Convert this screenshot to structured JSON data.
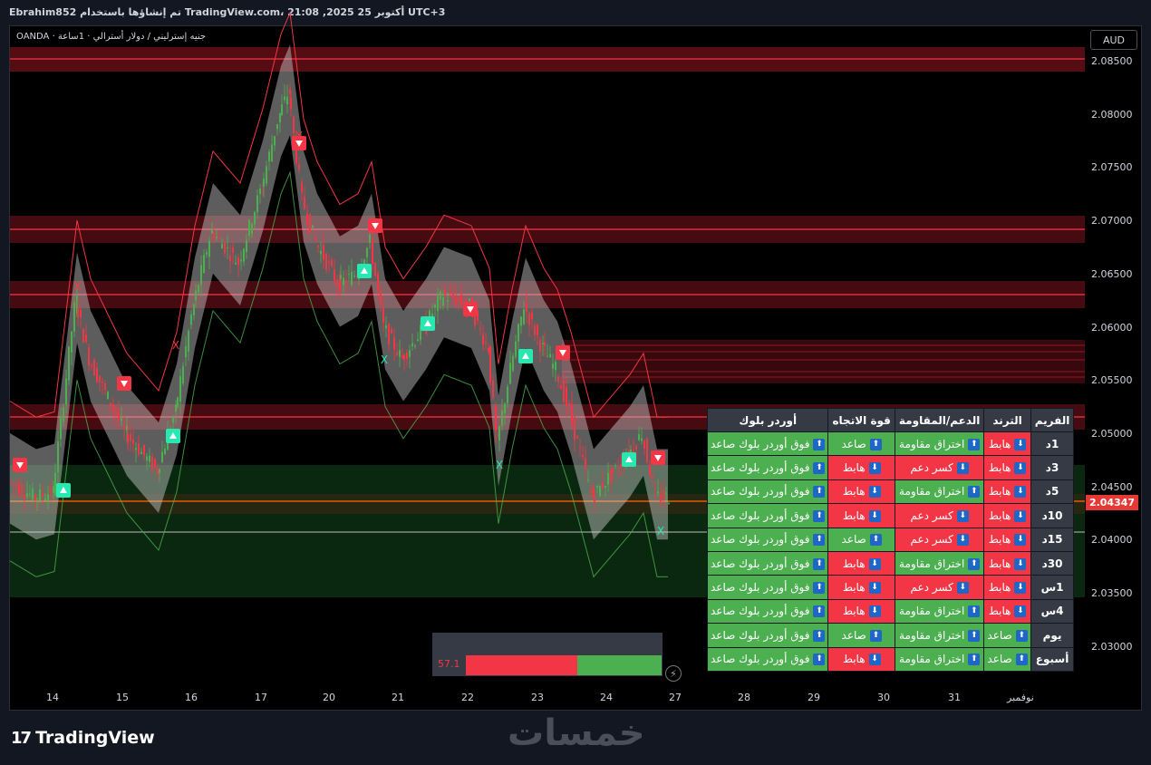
{
  "header": {
    "title": "Ebrahim852 تم إنشاؤها باستخدام TradingView.com، 21:08 ,2025 أكتوبر 25 UTC+3"
  },
  "symbol": {
    "label": "جنيه إسترليني / دولار أسترالي · 1ساعة · OANDA"
  },
  "currency_button": {
    "label": "AUD"
  },
  "price_axis": {
    "labels": [
      "2.08500",
      "2.08000",
      "2.07500",
      "2.07000",
      "2.06500",
      "2.06000",
      "2.05500",
      "2.05000",
      "2.04500",
      "2.04000",
      "2.03500",
      "2.03000"
    ],
    "last_price": "2.04347"
  },
  "time_axis": {
    "labels": [
      "14",
      "15",
      "16",
      "17",
      "20",
      "21",
      "22",
      "23",
      "24",
      "27",
      "28",
      "29",
      "30",
      "31",
      "نوفمبر"
    ]
  },
  "markers": {
    "x_label": "X"
  },
  "table": {
    "headers": [
      "الفريم",
      "الترند",
      "الدعم/المقاومة",
      "قوة الاتجاه",
      "أوردر بلوك"
    ],
    "rows": [
      {
        "frame": "1د",
        "trend": "هابط",
        "sr": "اختراق مقاومة",
        "strength": "صاعد",
        "ob": "فوق أوردر بلوك صاعد"
      },
      {
        "frame": "3د",
        "trend": "هابط",
        "sr": "كسر دعم",
        "strength": "هابط",
        "ob": "فوق أوردر بلوك صاعد"
      },
      {
        "frame": "5د",
        "trend": "هابط",
        "sr": "اختراق مقاومة",
        "strength": "هابط",
        "ob": "فوق أوردر بلوك صاعد"
      },
      {
        "frame": "10د",
        "trend": "هابط",
        "sr": "كسر دعم",
        "strength": "هابط",
        "ob": "فوق أوردر بلوك صاعد"
      },
      {
        "frame": "15د",
        "trend": "هابط",
        "sr": "كسر دعم",
        "strength": "صاعد",
        "ob": "فوق أوردر بلوك صاعد"
      },
      {
        "frame": "30د",
        "trend": "هابط",
        "sr": "اختراق مقاومة",
        "strength": "هابط",
        "ob": "فوق أوردر بلوك صاعد"
      },
      {
        "frame": "1س",
        "trend": "هابط",
        "sr": "كسر دعم",
        "strength": "هابط",
        "ob": "فوق أوردر بلوك صاعد"
      },
      {
        "frame": "4س",
        "trend": "هابط",
        "sr": "اختراق مقاومة",
        "strength": "هابط",
        "ob": "فوق أوردر بلوك صاعد"
      },
      {
        "frame": "يوم",
        "trend": "صاعد",
        "sr": "اختراق مقاومة",
        "strength": "صاعد",
        "ob": "فوق أوردر بلوك صاعد"
      },
      {
        "frame": "أسبوع",
        "trend": "صاعد",
        "sr": "اختراق مقاومة",
        "strength": "هابط",
        "ob": "فوق أوردر بلوك صاعد"
      }
    ]
  },
  "meter": {
    "bear": "57.1",
    "bull": "42.9",
    "bear_value": 57.1,
    "bull_value": 42.9
  },
  "footer": {
    "brand": "TradingView",
    "watermark": "خمسات"
  },
  "colors": {
    "up": "#4caf50",
    "down": "#f23645",
    "teal": "#26e8b0",
    "panel": "#363a45"
  }
}
